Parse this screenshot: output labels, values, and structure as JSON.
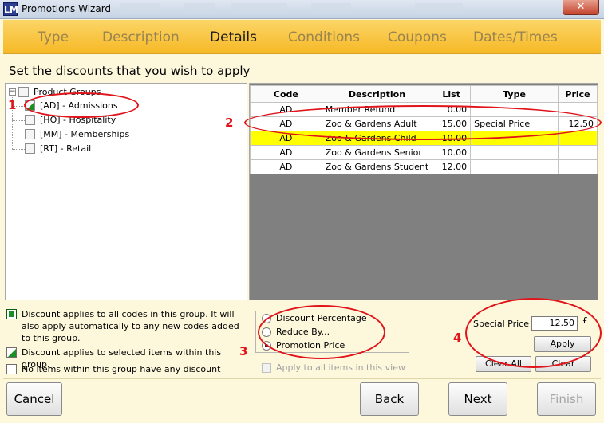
{
  "window": {
    "title": "Promotions Wizard",
    "icon_text": "LM",
    "close_glyph": "✕"
  },
  "tabs": [
    {
      "label": "Type",
      "state": "inactive"
    },
    {
      "label": "Description",
      "state": "inactive"
    },
    {
      "label": "Details",
      "state": "active"
    },
    {
      "label": "Conditions",
      "state": "inactive"
    },
    {
      "label": "Coupons",
      "state": "strikethrough"
    },
    {
      "label": "Dates/Times",
      "state": "inactive"
    }
  ],
  "heading": "Set the discounts that you wish to apply",
  "tree": {
    "root": {
      "label": "Product Groups",
      "expander": "−"
    },
    "items": [
      {
        "label": "[AD] - Admissions",
        "state": "partial"
      },
      {
        "label": "[HO] - Hospitality",
        "state": "none"
      },
      {
        "label": "[MM] - Memberships",
        "state": "none"
      },
      {
        "label": "[RT] - Retail",
        "state": "none"
      }
    ]
  },
  "grid": {
    "columns": [
      "Code",
      "Description",
      "List",
      "Type",
      "Price"
    ],
    "rows": [
      {
        "code": "AD",
        "description": "Member Refund",
        "list": "0.00",
        "type": "",
        "price": "",
        "highlight": false
      },
      {
        "code": "AD",
        "description": "Zoo & Gardens Adult",
        "list": "15.00",
        "type": "Special Price",
        "price": "12.50",
        "highlight": false
      },
      {
        "code": "AD",
        "description": "Zoo & Gardens Child",
        "list": "10.00",
        "type": "",
        "price": "",
        "highlight": true
      },
      {
        "code": "AD",
        "description": "Zoo & Gardens Senior",
        "list": "10.00",
        "type": "",
        "price": "",
        "highlight": false
      },
      {
        "code": "AD",
        "description": "Zoo & Gardens Student",
        "list": "12.00",
        "type": "",
        "price": "",
        "highlight": false
      }
    ]
  },
  "legend": [
    {
      "text": "Discount applies to all codes in this group. It will also apply automatically to any new codes added to this group.",
      "state": "full"
    },
    {
      "text": "Discount applies to selected items within this group.",
      "state": "partial"
    },
    {
      "text": "No items within this group have any discount applied.",
      "state": "none"
    }
  ],
  "discount_options": [
    {
      "label": "Discount Percentage",
      "selected": false
    },
    {
      "label": "Reduce By...",
      "selected": false
    },
    {
      "label": "Promotion Price",
      "selected": true
    }
  ],
  "apply_all_label": "Apply to all items in this view",
  "special_price": {
    "label": "Special Price",
    "value": "12.50",
    "currency": "£"
  },
  "buttons": {
    "apply": "Apply",
    "clear_all": "Clear All",
    "clear": "Clear",
    "cancel": "Cancel",
    "back": "Back",
    "next": "Next",
    "finish": "Finish"
  },
  "annotations": [
    "1",
    "2",
    "3",
    "4"
  ],
  "colors": {
    "accent_red": "#e0141a",
    "tab_bar": "#f8c43c",
    "highlight_row": "#ffff00",
    "check_green": "#1a8f26"
  }
}
